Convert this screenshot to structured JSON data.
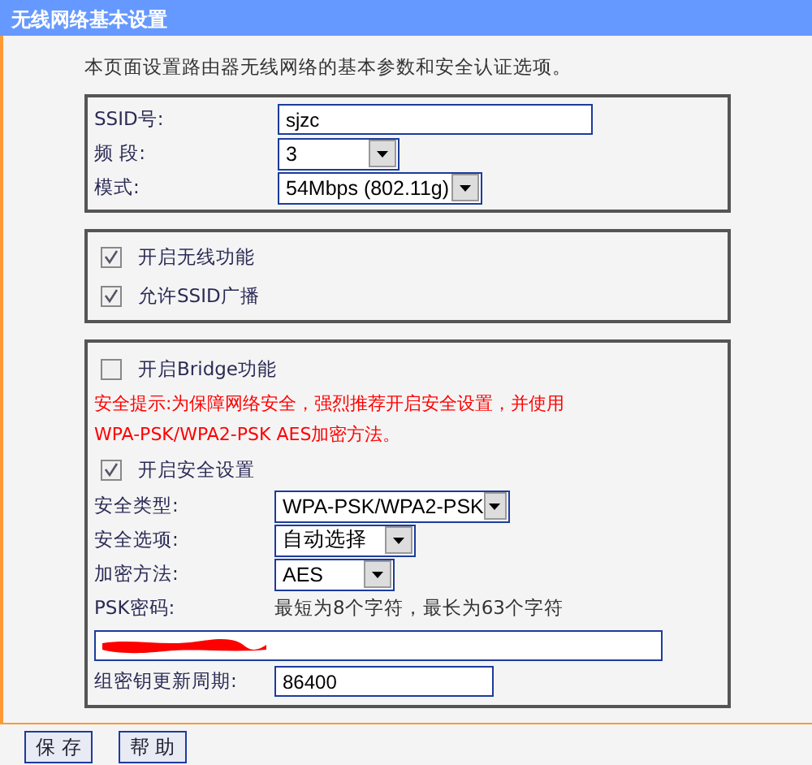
{
  "title": "无线网络基本设置",
  "intro": "本页面设置路由器无线网络的基本参数和安全认证选项。",
  "basic": [
    {
      "kind": "text",
      "label": "SSID号:",
      "value": "sjzc"
    },
    {
      "kind": "select",
      "label": "频 段:",
      "value": "3"
    },
    {
      "kind": "select",
      "label": "模式:",
      "value": "54Mbps (802.11g)"
    }
  ],
  "switches": [
    {
      "label": "开启无线功能",
      "checked": true
    },
    {
      "label": "允许SSID广播",
      "checked": true
    }
  ],
  "security": {
    "bridge": {
      "label": "开启Bridge功能",
      "checked": false
    },
    "warning": [
      "安全提示:为保障网络安全，强烈推荐开启安全设置，并使用",
      "WPA-PSK/WPA2-PSK AES加密方法。"
    ],
    "enable": {
      "label": "开启安全设置",
      "checked": true
    },
    "fields": [
      {
        "kind": "select",
        "label": "安全类型:",
        "value": "WPA-PSK/WPA2-PSK"
      },
      {
        "kind": "select",
        "label": "安全选项:",
        "value": "自动选择"
      },
      {
        "kind": "select",
        "label": "加密方法:",
        "value": "AES"
      },
      {
        "kind": "hint",
        "label": "PSK密码:",
        "hint": "最短为8个字符，最长为63个字符"
      },
      {
        "kind": "password",
        "redacted": true
      },
      {
        "kind": "text",
        "label": "组密钥更新周期:",
        "value": "86400"
      }
    ]
  },
  "buttons": [
    "保 存",
    "帮 助"
  ]
}
